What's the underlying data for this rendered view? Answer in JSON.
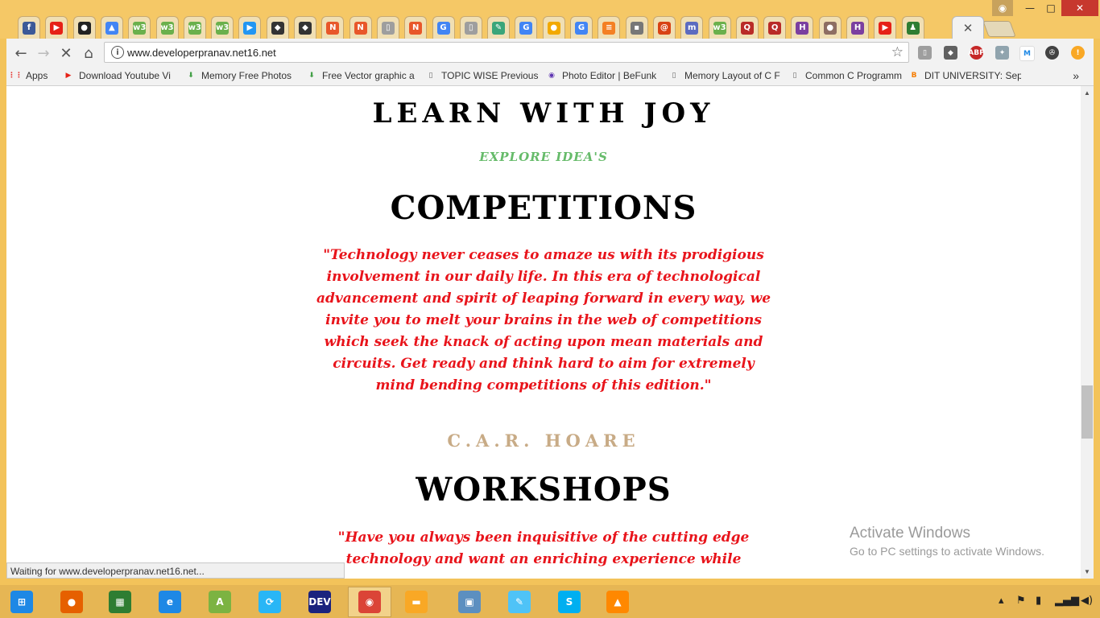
{
  "tabs": [
    {
      "icon": "facebook-icon",
      "glyph": "f",
      "color": "#3b5998"
    },
    {
      "icon": "youtube-icon",
      "glyph": "▶",
      "color": "#e62117"
    },
    {
      "icon": "github-icon",
      "glyph": "●",
      "color": "#222222"
    },
    {
      "icon": "google-drive-icon",
      "glyph": "▲",
      "color": "#4285f4"
    },
    {
      "icon": "w3schools-icon",
      "glyph": "w3",
      "color": "#6ab04c"
    },
    {
      "icon": "w3schools-icon",
      "glyph": "w3",
      "color": "#6ab04c"
    },
    {
      "icon": "w3schools-icon",
      "glyph": "w3",
      "color": "#6ab04c"
    },
    {
      "icon": "w3schools-icon",
      "glyph": "w3",
      "color": "#6ab04c"
    },
    {
      "icon": "play-circle-icon",
      "glyph": "▶",
      "color": "#2196f3"
    },
    {
      "icon": "wolf-icon",
      "glyph": "◆",
      "color": "#333333"
    },
    {
      "icon": "wolf-icon",
      "glyph": "◆",
      "color": "#333333"
    },
    {
      "icon": "n-logo-icon",
      "glyph": "N",
      "color": "#e8572a"
    },
    {
      "icon": "n-logo-icon",
      "glyph": "N",
      "color": "#e8572a"
    },
    {
      "icon": "page-icon",
      "glyph": "▯",
      "color": "#9e9e9e"
    },
    {
      "icon": "n-logo-icon",
      "glyph": "N",
      "color": "#e8572a"
    },
    {
      "icon": "google-icon",
      "glyph": "G",
      "color": "#4285f4"
    },
    {
      "icon": "page-icon",
      "glyph": "▯",
      "color": "#9e9e9e"
    },
    {
      "icon": "edit-icon",
      "glyph": "✎",
      "color": "#3aa57a"
    },
    {
      "icon": "google-icon",
      "glyph": "G",
      "color": "#4285f4"
    },
    {
      "icon": "circle-icon",
      "glyph": "●",
      "color": "#f2a900"
    },
    {
      "icon": "google-icon",
      "glyph": "G",
      "color": "#4285f4"
    },
    {
      "icon": "stackoverflow-icon",
      "glyph": "≡",
      "color": "#f48024"
    },
    {
      "icon": "site-logo-icon",
      "glyph": "▪",
      "color": "#777777"
    },
    {
      "icon": "swirl-icon",
      "glyph": "@",
      "color": "#d84315"
    },
    {
      "icon": "m-logo-icon",
      "glyph": "m",
      "color": "#5c6bc0"
    },
    {
      "icon": "w3schools-icon",
      "glyph": "w3",
      "color": "#6ab04c"
    },
    {
      "icon": "quora-icon",
      "glyph": "Q",
      "color": "#b92b27"
    },
    {
      "icon": "quora-icon",
      "glyph": "Q",
      "color": "#b92b27"
    },
    {
      "icon": "hackerearth-icon",
      "glyph": "H",
      "color": "#7b3fa0"
    },
    {
      "icon": "owl-icon",
      "glyph": "●",
      "color": "#8d6e63"
    },
    {
      "icon": "hackerearth-icon",
      "glyph": "H",
      "color": "#7b3fa0"
    },
    {
      "icon": "youtube-icon",
      "glyph": "▶",
      "color": "#e62117"
    },
    {
      "icon": "figure-icon",
      "glyph": "♟",
      "color": "#2e7d32"
    }
  ],
  "omnibox": {
    "url": "www.developerpranav.net16.net"
  },
  "bookmarks": [
    {
      "label": "Apps",
      "icon": "apps-grid-icon",
      "glyph": "⋮⋮",
      "color": "#e53935"
    },
    {
      "label": "Download Youtube Vi",
      "icon": "youtube-icon",
      "glyph": "▶",
      "color": "#e62117"
    },
    {
      "label": "Memory Free Photos",
      "icon": "download-arrow-icon",
      "glyph": "⬇",
      "color": "#43a047"
    },
    {
      "label": "Free Vector graphic a",
      "icon": "download-arrow-icon",
      "glyph": "⬇",
      "color": "#43a047"
    },
    {
      "label": "TOPIC WISE Previous",
      "icon": "page-icon",
      "glyph": "▯",
      "color": "#666666"
    },
    {
      "label": "Photo Editor | BeFunk",
      "icon": "befunky-icon",
      "glyph": "◉",
      "color": "#5e35b1"
    },
    {
      "label": "Memory Layout of C F",
      "icon": "page-icon",
      "glyph": "▯",
      "color": "#666666"
    },
    {
      "label": "Common C Programm",
      "icon": "page-icon",
      "glyph": "▯",
      "color": "#666666"
    },
    {
      "label": "DIT UNIVERSITY: Sept",
      "icon": "blogger-icon",
      "glyph": "B",
      "color": "#f57c00"
    }
  ],
  "page": {
    "site_title": "LEARN WITH JOY",
    "site_subtitle": "EXPLORE IDEA'S",
    "competitions_title": "COMPETITIONS",
    "competitions_quote": "\"Technology never ceases to amaze us with its prodigious involvement in our daily life. In this era of technological advancement and spirit of leaping forward in every way, we invite you to melt your brains in the web of competitions which seek the knack of acting upon mean materials and circuits. Get ready and think hard to aim for extremely mind bending competitions of this edition.\"",
    "competitions_author": "C.A.R. HOARE",
    "workshops_title": "WORKSHOPS",
    "workshops_quote": "\"Have you always been inquisitive of the cutting edge technology and want an enriching experience while"
  },
  "watermark": {
    "line1": "Activate Windows",
    "line2": "Go to PC settings to activate Windows."
  },
  "status": "Waiting for www.developerpranav.net16.net...",
  "taskbar": [
    {
      "icon": "windows-start-icon",
      "glyph": "⊞",
      "color": "#1e88e5"
    },
    {
      "icon": "firefox-icon",
      "glyph": "●",
      "color": "#e66000"
    },
    {
      "icon": "windows-store-icon",
      "glyph": "▦",
      "color": "#2e7d32"
    },
    {
      "icon": "internet-explorer-icon",
      "glyph": "e",
      "color": "#1e88e5"
    },
    {
      "icon": "android-studio-icon",
      "glyph": "A",
      "color": "#7cb342"
    },
    {
      "icon": "share-app-icon",
      "glyph": "⟳",
      "color": "#29b6f6"
    },
    {
      "icon": "dev-cpp-icon",
      "glyph": "DEV",
      "color": "#1a237e"
    },
    {
      "icon": "chrome-icon",
      "glyph": "◉",
      "color": "#db4437"
    },
    {
      "icon": "file-explorer-icon",
      "glyph": "▬",
      "color": "#f9a825"
    },
    {
      "icon": "photos-icon",
      "glyph": "▣",
      "color": "#5c8fc0"
    },
    {
      "icon": "notepad-icon",
      "glyph": "✎",
      "color": "#4fc3f7"
    },
    {
      "icon": "skype-icon",
      "glyph": "S",
      "color": "#00aff0"
    },
    {
      "icon": "vlc-icon",
      "glyph": "▲",
      "color": "#ff8800"
    }
  ]
}
